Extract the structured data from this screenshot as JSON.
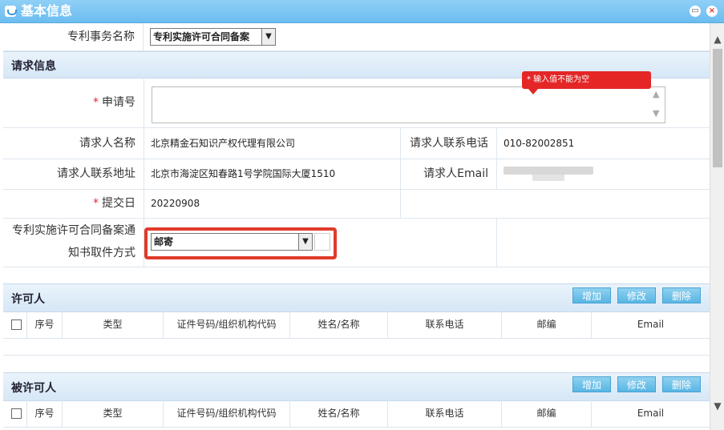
{
  "window": {
    "title": "基本信息",
    "max_glyph": "▭",
    "close_glyph": "×"
  },
  "colors": {
    "titlebar": "#6cbdf0",
    "error": "#e52626",
    "button": "#58b6e4"
  },
  "form": {
    "matter_label": "专利事务名称",
    "matter_value": "专利实施许可合同备案",
    "request_section": "请求信息",
    "application_no_label": "申请号",
    "application_no_value": "",
    "error_tip": "* 输入值不能为空",
    "requester_name_label": "请求人名称",
    "requester_name_value": "北京精金石知识产权代理有限公司",
    "requester_phone_label": "请求人联系电话",
    "requester_phone_value": "010-82002851",
    "requester_addr_label": "请求人联系地址",
    "requester_addr_value": "北京市海淀区知春路1号学院国际大厦1510",
    "requester_email_label": "请求人Email",
    "submit_date_label": "提交日",
    "submit_date_value": "20220908",
    "pickup_label_line1": "专利实施许可合同备案通",
    "pickup_label_line2": "知书取件方式",
    "pickup_value": "邮寄"
  },
  "licensor": {
    "title": "许可人",
    "buttons": [
      "增加",
      "修改",
      "删除"
    ],
    "columns": [
      "序号",
      "类型",
      "证件号码/组织机构代码",
      "姓名/名称",
      "联系电话",
      "邮编",
      "Email"
    ]
  },
  "licensee": {
    "title": "被许可人",
    "buttons": [
      "增加",
      "修改",
      "删除"
    ],
    "columns": [
      "序号",
      "类型",
      "证件号码/组织机构代码",
      "姓名/名称",
      "联系电话",
      "邮编",
      "Email"
    ]
  }
}
